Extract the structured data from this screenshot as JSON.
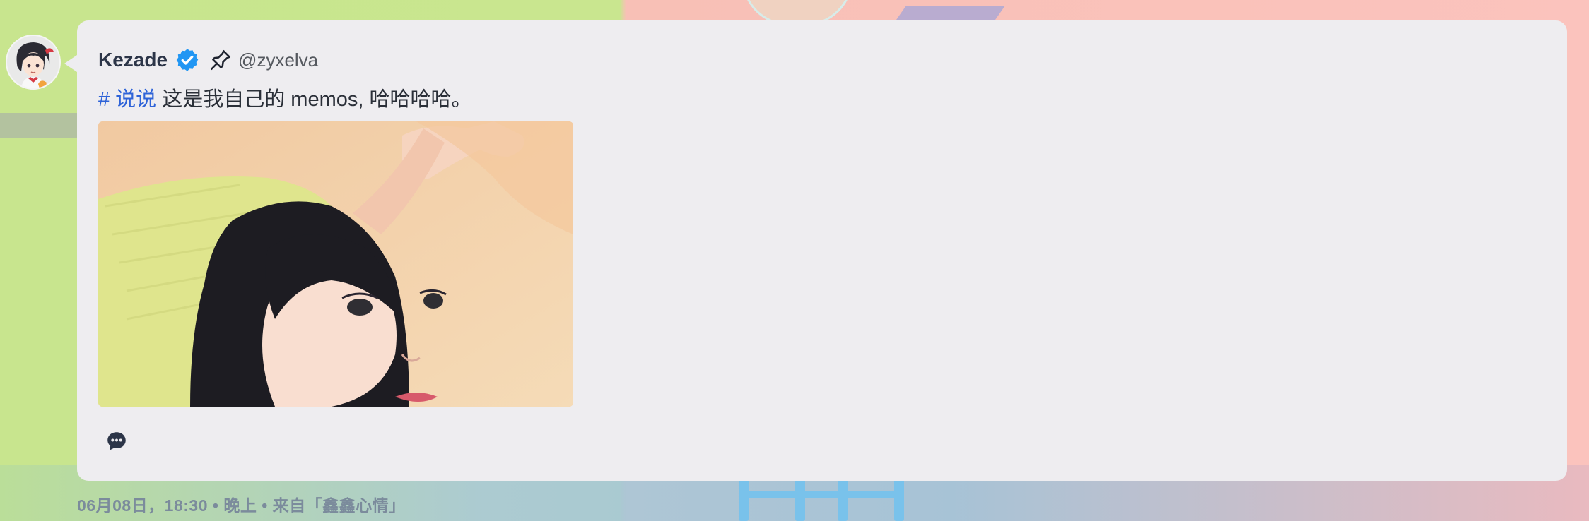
{
  "post": {
    "author_name": "Kezade",
    "handle": "@zyxelva",
    "tag": "# 说说",
    "text": " 这是我自己的 memos, 哈哈哈哈。",
    "verified_icon": "verified-check-icon",
    "pin_icon": "pin-icon",
    "comment_icon": "comment-icon",
    "accent_color": "#2e63d8",
    "verified_color": "#2196f3"
  },
  "footer": {
    "meta": "06月08日，18:30 • 晚上 • 来自「鑫鑫心情」"
  }
}
